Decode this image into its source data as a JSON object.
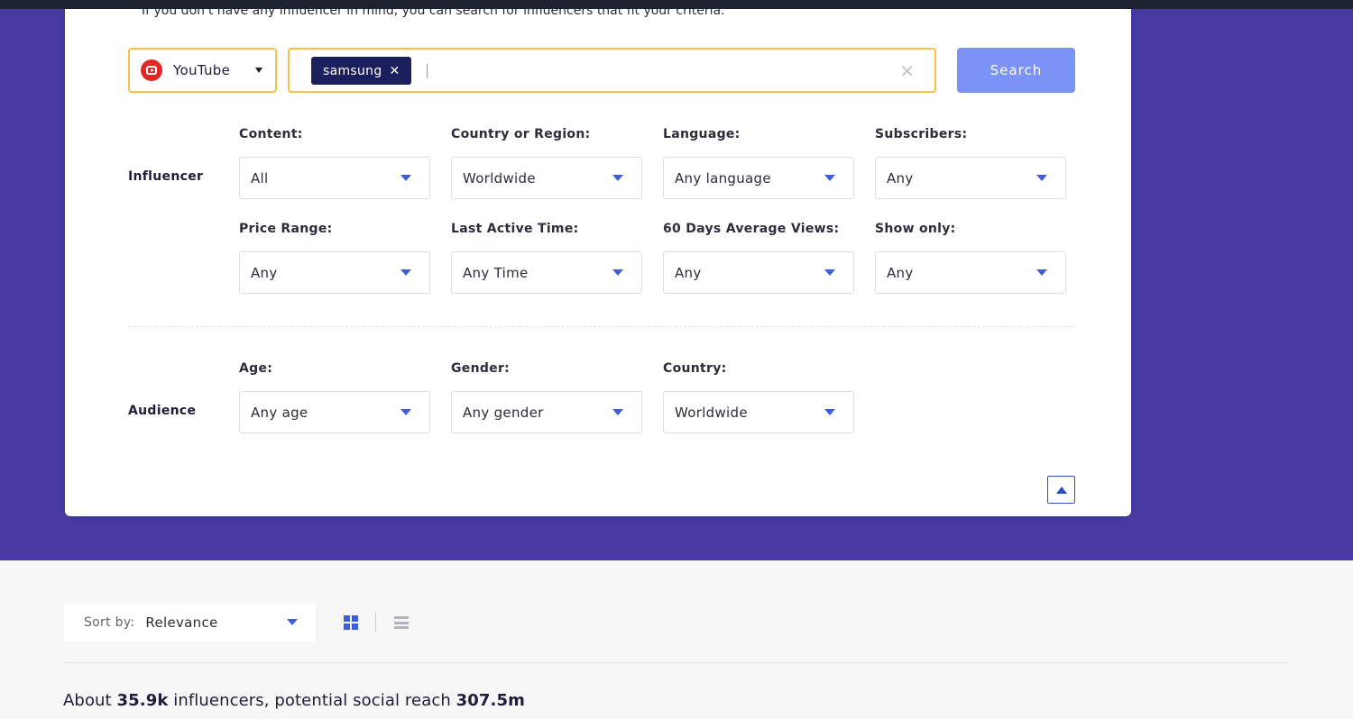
{
  "intro_text": "If you don't have any influencer in mind, you can search for influencers that fit your criteria.",
  "platform": {
    "label": "YouTube",
    "icon": "youtube-icon"
  },
  "keyword": {
    "chip": "samsung"
  },
  "search_button": "Search",
  "influencer": {
    "title": "Influencer",
    "filters": [
      {
        "label": "Content:",
        "value": "All"
      },
      {
        "label": "Country or Region:",
        "value": "Worldwide"
      },
      {
        "label": "Language:",
        "value": "Any language"
      },
      {
        "label": "Subscribers:",
        "value": "Any"
      },
      {
        "label": "Price Range:",
        "value": "Any"
      },
      {
        "label": "Last Active Time:",
        "value": "Any Time"
      },
      {
        "label": "60 Days Average Views:",
        "value": "Any"
      },
      {
        "label": "Show only:",
        "value": "Any"
      }
    ]
  },
  "audience": {
    "title": "Audience",
    "filters": [
      {
        "label": "Age:",
        "value": "Any age"
      },
      {
        "label": "Gender:",
        "value": "Any gender"
      },
      {
        "label": "Country:",
        "value": "Worldwide"
      }
    ]
  },
  "sort": {
    "label": "Sort by:",
    "value": "Relevance"
  },
  "summary": {
    "prefix": "About ",
    "count": "35.9k",
    "middle": " influencers, potential social reach ",
    "reach": "307.5m"
  },
  "colors": {
    "hero": "#473ba2",
    "accent": "#3e5ed8",
    "highlight": "#f7c04a",
    "button": "#7b93f7"
  }
}
